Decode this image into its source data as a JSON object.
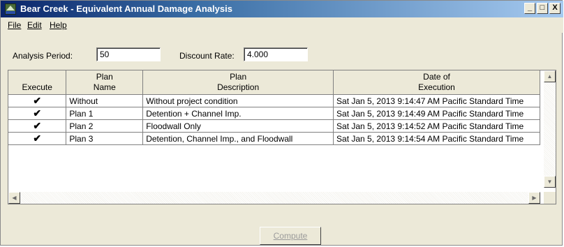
{
  "window": {
    "title": "Bear Creek - Equivalent Annual Damage Analysis",
    "controls": {
      "minimize": "_",
      "maximize": "□",
      "close": "X"
    }
  },
  "menu": {
    "items": [
      {
        "label": "File"
      },
      {
        "label": "Edit"
      },
      {
        "label": "Help"
      }
    ]
  },
  "form": {
    "analysis_period_label": "Analysis Period:",
    "analysis_period_value": "50",
    "discount_rate_label": "Discount Rate:",
    "discount_rate_value": "4.000"
  },
  "grid": {
    "headers": {
      "execute": "Execute",
      "plan_name_1": "Plan",
      "plan_name_2": "Name",
      "plan_desc_1": "Plan",
      "plan_desc_2": "Description",
      "date_1": "Date of",
      "date_2": "Execution"
    },
    "rows": [
      {
        "execute": "✔",
        "name": "Without",
        "description": "Without project condition",
        "date": "Sat Jan 5, 2013 9:14:47 AM Pacific Standard Time"
      },
      {
        "execute": "✔",
        "name": "Plan 1",
        "description": "Detention + Channel Imp.",
        "date": "Sat Jan 5, 2013 9:14:49 AM Pacific Standard Time"
      },
      {
        "execute": "✔",
        "name": "Plan 2",
        "description": "Floodwall Only",
        "date": "Sat Jan 5, 2013 9:14:52 AM Pacific Standard Time"
      },
      {
        "execute": "✔",
        "name": "Plan 3",
        "description": "Detention, Channel Imp., and Floodwall",
        "date": "Sat Jan 5, 2013 9:14:54 AM Pacific Standard Time"
      }
    ]
  },
  "actions": {
    "compute_label": "Compute"
  },
  "colors": {
    "title_gradient_start": "#0a246a",
    "title_gradient_end": "#a6caf0",
    "window_face": "#ece9d8"
  }
}
